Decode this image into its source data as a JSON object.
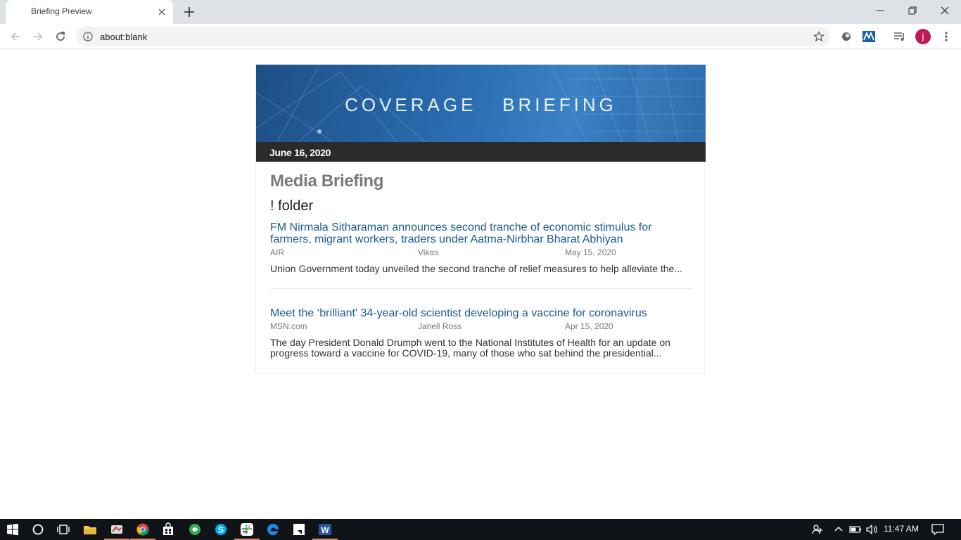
{
  "browser": {
    "tab_title": "Briefing Preview",
    "url": "about:blank",
    "avatar_letter": "j"
  },
  "briefing": {
    "banner_title": "COVERAGE   BRIEFING",
    "date": "June 16, 2020",
    "heading": "Media Briefing",
    "folder": "! folder",
    "articles": [
      {
        "title": "FM Nirmala Sitharaman announces second tranche of economic stimulus for farmers, migrant workers, traders under Aatma-Nirbhar Bharat Abhiyan",
        "source": "AIR",
        "author": "Vikas",
        "date": "May 15, 2020",
        "summary": "Union Government today unveiled the second tranche of relief measures to help alleviate the..."
      },
      {
        "title": "Meet the ‘brilliant' 34-year-old scientist developing a vaccine for coronavirus",
        "source": "MSN.com",
        "author": "Janell Ross",
        "date": "Apr 15, 2020",
        "summary": "The day President Donald Drumph went to the National Institutes of Health for an update on progress toward a vaccine for COVID-19, many of those who sat behind the presidential..."
      }
    ]
  },
  "taskbar": {
    "time": "11:47 AM",
    "pinned_icons": [
      "windows-start-icon",
      "cortana-search-icon",
      "task-view-icon",
      "file-explorer-icon",
      "app-icon",
      "chrome-icon",
      "store-icon",
      "green-app-icon",
      "skype-icon",
      "slack-icon",
      "edge-icon",
      "sticky-notes-icon",
      "word-icon"
    ]
  },
  "colors": {
    "accent_link": "#1c5a96",
    "banner_blue": "#2a6db0",
    "date_bar": "#2b2b2b",
    "avatar": "#c2185b"
  }
}
